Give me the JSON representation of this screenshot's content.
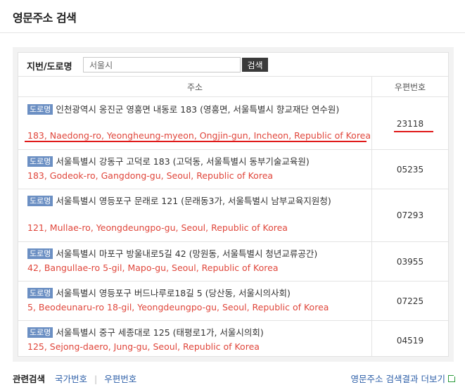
{
  "header": {
    "title": "영문주소 검색"
  },
  "search": {
    "label": "지번/도로명",
    "value": "서울시",
    "button_label": "검색"
  },
  "table": {
    "col_address": "주소",
    "col_zip": "우편번호",
    "badge": "도로명",
    "rows": [
      {
        "kor": "인천광역시 옹진군 영흥면 내동로 183 (영흥면, 서울특별시 향교재단 연수원)",
        "eng": "183, Naedong-ro, Yeongheung-myeon, Ongjin-gun, Incheon, Republic of Korea",
        "zip": "23118"
      },
      {
        "kor": "서울특별시 강동구 고덕로 183 (고덕동, 서울특별시 동부기술교육원)",
        "eng": "183, Godeok-ro, Gangdong-gu, Seoul, Republic of Korea",
        "zip": "05235"
      },
      {
        "kor": "서울특별시 영등포구 문래로 121 (문래동3가, 서울특별시 남부교육지원청)",
        "eng": "121, Mullae-ro, Yeongdeungpo-gu, Seoul, Republic of Korea",
        "zip": "07293"
      },
      {
        "kor": "서울특별시 마포구 방울내로5길 42 (망원동, 서울특별시 청년교류공간)",
        "eng": "42, Bangullae-ro 5-gil, Mapo-gu, Seoul, Republic of Korea",
        "zip": "03955"
      },
      {
        "kor": "서울특별시 영등포구 버드나루로18길 5 (당산동, 서울시의사회)",
        "eng": "5, Beodeunaru-ro 18-gil, Yeongdeungpo-gu, Seoul, Republic of Korea",
        "zip": "07225"
      },
      {
        "kor": "서울특별시 중구 세종대로 125 (태평로1가, 서울시의회)",
        "eng": "125, Sejong-daero, Jung-gu, Seoul, Republic of Korea",
        "zip": "04519"
      }
    ]
  },
  "footer": {
    "related_label": "관련검색",
    "links": [
      "국가번호",
      "우편번호"
    ],
    "more_link": "영문주소 검색결과 더보기"
  },
  "colors": {
    "highlight": "#e01a1a",
    "english_text": "#e0463b",
    "badge": "#6b8fc3",
    "link": "#2d5fa8"
  },
  "icons": {
    "more": "external-link-icon"
  }
}
